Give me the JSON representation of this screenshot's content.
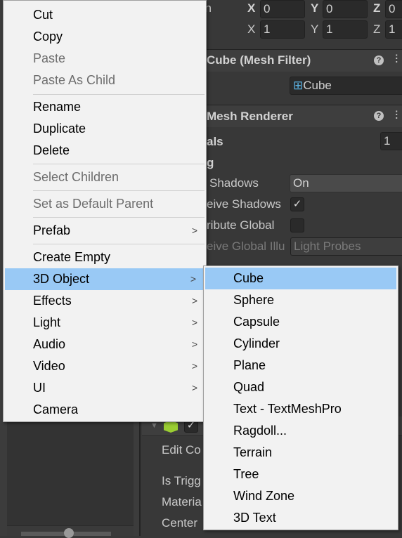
{
  "inspector": {
    "transform": {
      "position_label": "on",
      "x_label": "X",
      "y_label": "Y",
      "z_label": "Z",
      "pos_x": "0",
      "pos_y": "0",
      "pos_z": "0",
      "scale_x": "1",
      "scale_y": "1",
      "scale_z": "1"
    },
    "mesh_filter": {
      "title": "Cube (Mesh Filter)",
      "mesh_value": "Cube"
    },
    "mesh_renderer": {
      "title": "Mesh Renderer",
      "materials_label": "als",
      "materials_count": "1",
      "lighting_label": "g",
      "cast_shadows_label": "Shadows",
      "cast_shadows_value": "On",
      "receive_shadows_label": "eive Shadows",
      "receive_shadows_checked": true,
      "contribute_gi_label": "ribute Global",
      "contribute_gi_checked": false,
      "receive_gi_label": "eive Global Illu",
      "receive_gi_value": "Light Probes"
    },
    "collider": {
      "edit_label": "Edit Co",
      "is_trigger_label": "Is Trigg",
      "material_label": "Materia",
      "center_label": "Center"
    }
  },
  "context_menu": {
    "items": [
      {
        "label": "Cut",
        "enabled": true
      },
      {
        "label": "Copy",
        "enabled": true
      },
      {
        "label": "Paste",
        "enabled": false
      },
      {
        "label": "Paste As Child",
        "enabled": false
      },
      {
        "label": "Rename",
        "enabled": true
      },
      {
        "label": "Duplicate",
        "enabled": true
      },
      {
        "label": "Delete",
        "enabled": true
      },
      {
        "label": "Select Children",
        "enabled": false
      },
      {
        "label": "Set as Default Parent",
        "enabled": false
      },
      {
        "label": "Prefab",
        "enabled": true,
        "submenu": true
      },
      {
        "label": "Create Empty",
        "enabled": true
      },
      {
        "label": "3D Object",
        "enabled": true,
        "submenu": true,
        "highlighted": true
      },
      {
        "label": "Effects",
        "enabled": true,
        "submenu": true
      },
      {
        "label": "Light",
        "enabled": true,
        "submenu": true
      },
      {
        "label": "Audio",
        "enabled": true,
        "submenu": true
      },
      {
        "label": "Video",
        "enabled": true,
        "submenu": true
      },
      {
        "label": "UI",
        "enabled": true,
        "submenu": true
      },
      {
        "label": "Camera",
        "enabled": true
      }
    ],
    "submenu_arrow": ">"
  },
  "submenu_3d": {
    "items": [
      "Cube",
      "Sphere",
      "Capsule",
      "Cylinder",
      "Plane",
      "Quad",
      "Text - TextMeshPro",
      "Ragdoll...",
      "Terrain",
      "Tree",
      "Wind Zone",
      "3D Text"
    ],
    "highlighted": "Cube"
  },
  "colors": {
    "highlight": "#99c9f5",
    "menu_bg": "#f2f2f2",
    "editor_bg": "#383838"
  }
}
